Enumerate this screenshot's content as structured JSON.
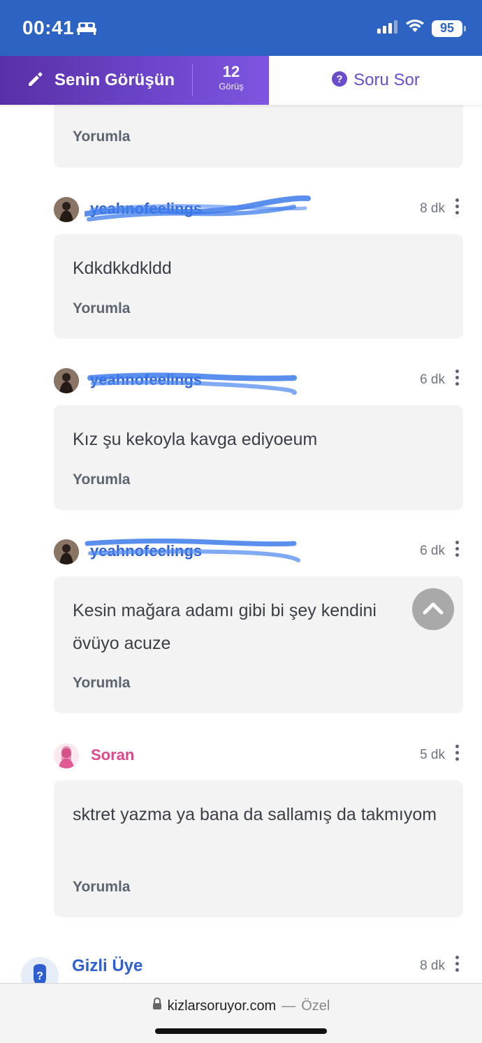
{
  "status_bar": {
    "time": "00:41",
    "battery": "95"
  },
  "action_bar": {
    "opinion_label": "Senin Görüşün",
    "view_count": "12",
    "view_label": "Görüş",
    "ask_label": "Soru Sor"
  },
  "comments": [
    {
      "text": "",
      "time": "",
      "reply_label": "Yorumla"
    },
    {
      "author": "yeahnofeelings",
      "time": "8 dk",
      "text": "Kdkdkkdkldd",
      "reply_label": "Yorumla"
    },
    {
      "author": "yeahnofeelings",
      "time": "6 dk",
      "text": "Kız şu kekoyla kavga ediyoeum",
      "reply_label": "Yorumla"
    },
    {
      "author": "yeahnofeelings",
      "time": "6 dk",
      "text": "Kesin mağara adamı gibi bi şey kendini övüyo acuze",
      "reply_label": "Yorumla"
    },
    {
      "author": "Soran",
      "time": "5 dk",
      "text": "sktret yazma ya bana da sallamış da takmıyom",
      "reply_label": "Yorumla"
    }
  ],
  "next_answer": {
    "author": "Gizli Üye",
    "time": "8 dk"
  },
  "browser": {
    "domain": "kizlarsoruyor.com",
    "separator": "—",
    "mode": "Özel"
  },
  "colors": {
    "status_bar": "#2d63c2",
    "opinion_gradient_start": "#5a2fa6",
    "opinion_gradient_end": "#7d55e0",
    "accent_purple": "#6a4ccf",
    "author_blue": "#2d5fd0",
    "asker_pink": "#e0478a",
    "card_bg": "#f3f3f3"
  },
  "icons": {
    "status": [
      "bed-icon",
      "signal-icon",
      "wifi-icon",
      "battery-icon"
    ],
    "action": [
      "pencil-icon",
      "question-circle-icon"
    ],
    "misc": [
      "kebab-menu-icon",
      "chevron-up-icon",
      "lock-icon"
    ]
  }
}
